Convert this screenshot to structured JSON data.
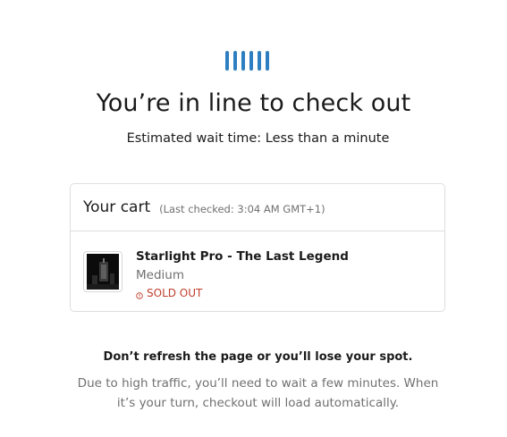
{
  "loader": {
    "bar_count": 6,
    "color": "#2d7fc1"
  },
  "queue": {
    "title": "You’re in line to check out",
    "wait_time": "Estimated wait time: Less than a minute"
  },
  "cart": {
    "title": "Your cart",
    "last_checked": "(Last checked: 3:04 AM GMT+1)",
    "items": [
      {
        "name": "Starlight Pro - The Last Legend",
        "variant": "Medium",
        "status": "SOLD OUT",
        "status_color": "#c0402e"
      }
    ]
  },
  "notice": {
    "warning": "Don’t refresh the page or you’ll lose your spot.",
    "info": "Due to high traffic, you’ll need to wait a few minutes. When it’s your turn, checkout will load automatically."
  }
}
